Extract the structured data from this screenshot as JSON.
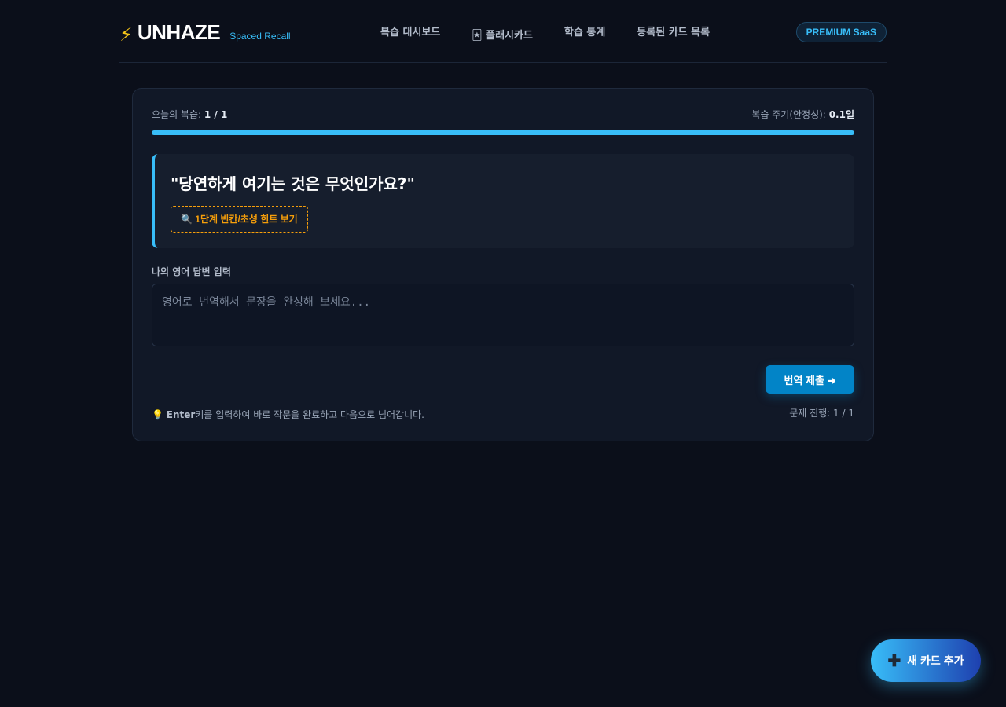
{
  "header": {
    "logo_icon": "lightning-bolt-icon",
    "logo_text": "UNHAZE",
    "logo_sub": "Spaced Recall",
    "nav": [
      {
        "label": "복습 대시보드"
      },
      {
        "label": "🃏 플래시카드"
      },
      {
        "label": "학습 통계"
      },
      {
        "label": "등록된 카드 목록"
      }
    ],
    "badge": "PREMIUM SaaS"
  },
  "review": {
    "today_label": "오늘의 복습:",
    "today_value": "1 / 1",
    "interval_label": "복습 주기(안정성):",
    "interval_value": "0.1일",
    "progress": 1.0,
    "question": "\"당연하게 여기는 것은 무엇인가요?\"",
    "hint_button": "🔍 1단계 빈칸/초성 힌트 보기",
    "answer_label": "나의 영어 답변 입력",
    "answer_placeholder": "영어로 번역해서 문장을 완성해 보세요...",
    "answer_value": "",
    "submit_button": "번역 제출 ➜",
    "tip_icon": "💡",
    "tip_key": "Enter",
    "tip_text": "키를 입력하여 바로 작문을 완료하고 다음으로 넘어갑니다.",
    "footer_progress": "문제 진행: 1 / 1"
  },
  "fab": {
    "icon": "+",
    "label": "새 카드 추가"
  },
  "colors": {
    "accent": "#38bdf8",
    "hint": "#f59e0b",
    "background": "#0b0f1a",
    "panel": "#111827"
  }
}
